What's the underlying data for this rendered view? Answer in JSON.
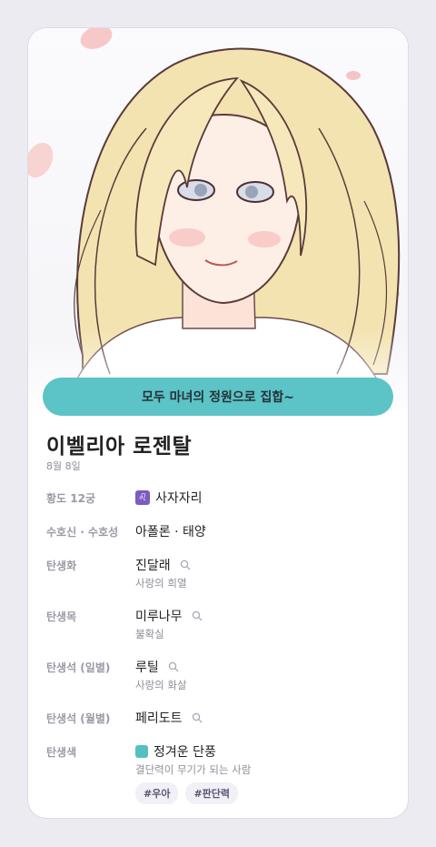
{
  "banner": {
    "text": "모두 마녀의 정원으로 집합~"
  },
  "profile": {
    "name": "이벨리아 로젠탈",
    "date": "8월 8일"
  },
  "rows": [
    {
      "label": "황도 12궁",
      "value": "사자자리",
      "icon": "♌",
      "icon_name": "leo-icon"
    },
    {
      "label": "수호신 · 수호성",
      "value": "아폴론 · 태양"
    },
    {
      "label": "탄생화",
      "value": "진달래",
      "sub": "사랑의 희열"
    },
    {
      "label": "탄생목",
      "value": "미루나무",
      "sub": "불확실"
    },
    {
      "label": "탄생석 (일별)",
      "value": "루틸",
      "sub": "사랑의 화살"
    },
    {
      "label": "탄생석 (월별)",
      "value": "페리도트"
    },
    {
      "label": "탄생색",
      "value": "정겨운 단풍",
      "sub": "결단력이 무기가 되는 사람",
      "color": "#55c0c2",
      "tags": [
        "#우아",
        "#판단력"
      ]
    }
  ]
}
